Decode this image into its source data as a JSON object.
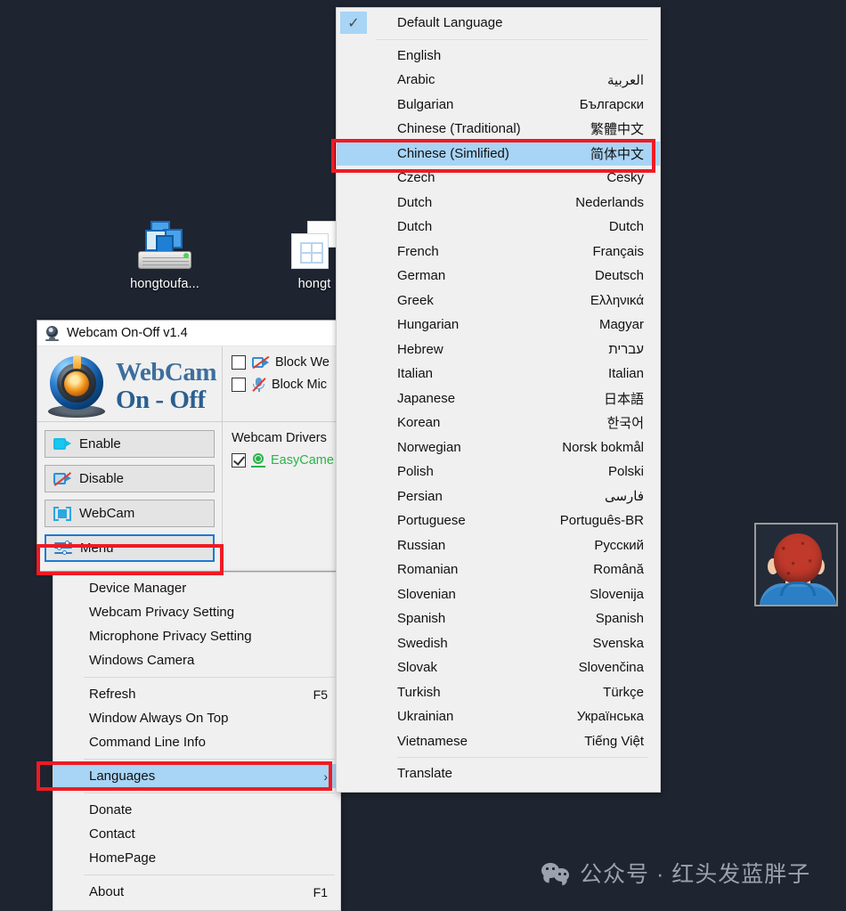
{
  "desktop": {
    "background_color": "#1e2430",
    "icons": [
      {
        "label": "hongtoufa...",
        "icon": "printer-scanner-icon"
      },
      {
        "label": "hongt",
        "icon": "window-folder-icon"
      }
    ]
  },
  "watermark": {
    "icon": "wechat-icon",
    "text": "公众号 · 红头发蓝胖子"
  },
  "avatar": {
    "name": "profile-thumbnail"
  },
  "app": {
    "title": "Webcam On-Off v1.4",
    "title_icon": "webcam-icon",
    "brand": {
      "line1": "WebCam",
      "line2": "On - Off",
      "logo": "webcam-logo"
    },
    "buttons": [
      {
        "label": "Enable",
        "icon": "camera-enable-icon",
        "selected": false
      },
      {
        "label": "Disable",
        "icon": "camera-disable-icon",
        "selected": false
      },
      {
        "label": "WebCam",
        "icon": "webcam-frame-icon",
        "selected": false
      },
      {
        "label": "Menu",
        "icon": "sliders-menu-icon",
        "selected": true
      }
    ],
    "checkboxes": [
      {
        "label": "Block We",
        "icon": "block-webcam-icon",
        "checked": false
      },
      {
        "label": "Block Mic",
        "icon": "block-microphone-icon",
        "checked": false
      }
    ],
    "drivers": {
      "header": "Webcam Drivers",
      "items": [
        {
          "label": "EasyCame",
          "checked": true,
          "icon": "camera-driver-icon",
          "color": "#2bb34b"
        }
      ]
    }
  },
  "context_menu": {
    "groups": [
      {
        "items": [
          {
            "label": "Device Manager",
            "accel": ""
          },
          {
            "label": "Webcam Privacy Setting",
            "accel": ""
          },
          {
            "label": "Microphone Privacy Setting",
            "accel": ""
          },
          {
            "label": "Windows Camera",
            "accel": ""
          }
        ]
      },
      {
        "items": [
          {
            "label": "Refresh",
            "accel": "F5"
          },
          {
            "label": "Window Always On Top",
            "accel": ""
          },
          {
            "label": "Command Line Info",
            "accel": ""
          }
        ]
      },
      {
        "items": [
          {
            "label": "Languages",
            "accel": "",
            "submenu": true,
            "highlighted": true
          }
        ]
      },
      {
        "items": [
          {
            "label": "Donate",
            "accel": ""
          },
          {
            "label": "Contact",
            "accel": ""
          },
          {
            "label": "HomePage",
            "accel": ""
          }
        ]
      },
      {
        "items": [
          {
            "label": "About",
            "accel": "F1"
          }
        ]
      }
    ]
  },
  "language_menu": {
    "header": {
      "label": "Default Language",
      "checked": true,
      "check_glyph": "✓"
    },
    "languages": [
      {
        "label": "English",
        "native": ""
      },
      {
        "label": "Arabic",
        "native": "العربية"
      },
      {
        "label": "Bulgarian",
        "native": "Български"
      },
      {
        "label": "Chinese (Traditional)",
        "native": "繁體中文"
      },
      {
        "label": "Chinese (Simlified)",
        "native": "简体中文",
        "highlighted": true
      },
      {
        "label": "Czech",
        "native": "Cesky"
      },
      {
        "label": "Dutch",
        "native": "Nederlands"
      },
      {
        "label": "Dutch",
        "native": "Dutch"
      },
      {
        "label": "French",
        "native": "Français"
      },
      {
        "label": "German",
        "native": "Deutsch"
      },
      {
        "label": "Greek",
        "native": "Ελληνικά"
      },
      {
        "label": "Hungarian",
        "native": "Magyar"
      },
      {
        "label": "Hebrew",
        "native": "עברית"
      },
      {
        "label": "Italian",
        "native": "Italian"
      },
      {
        "label": "Japanese",
        "native": "日本語"
      },
      {
        "label": "Korean",
        "native": "한국어"
      },
      {
        "label": "Norwegian",
        "native": "Norsk bokmål"
      },
      {
        "label": "Polish",
        "native": "Polski"
      },
      {
        "label": "Persian",
        "native": "فارسی"
      },
      {
        "label": "Portuguese",
        "native": "Português-BR"
      },
      {
        "label": "Russian",
        "native": "Русский"
      },
      {
        "label": "Romanian",
        "native": "Română"
      },
      {
        "label": "Slovenian",
        "native": "Slovenija"
      },
      {
        "label": "Spanish",
        "native": "Spanish"
      },
      {
        "label": "Swedish",
        "native": "Svenska"
      },
      {
        "label": "Slovak",
        "native": "Slovenčina"
      },
      {
        "label": "Turkish",
        "native": "Türkçe"
      },
      {
        "label": "Ukrainian",
        "native": "Українська"
      },
      {
        "label": "Vietnamese",
        "native": "Tiếng Việt"
      }
    ],
    "footer": {
      "label": "Translate"
    }
  },
  "annotations": {
    "highlight_color": "#ee1b24",
    "selection_color": "#a8d4f5",
    "boxes": [
      {
        "name": "chinese-simplified-highlight"
      },
      {
        "name": "menu-button-highlight"
      },
      {
        "name": "languages-item-highlight"
      }
    ]
  }
}
